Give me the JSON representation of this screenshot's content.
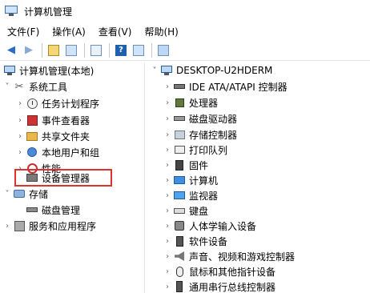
{
  "window": {
    "title": "计算机管理"
  },
  "menubar": {
    "items": [
      "文件(F)",
      "操作(A)",
      "查看(V)",
      "帮助(H)"
    ]
  },
  "toolbar": {
    "buttons": [
      "back-arrow",
      "forward-arrow",
      "up-folder",
      "show-hide-tree",
      "properties",
      "help",
      "view",
      "monitor"
    ]
  },
  "left_tree": {
    "root": "计算机管理(本地)",
    "system_tools": "系统工具",
    "task_scheduler": "任务计划程序",
    "event_viewer": "事件查看器",
    "shared_folders": "共享文件夹",
    "local_users": "本地用户和组",
    "performance": "性能",
    "device_manager": "设备管理器",
    "storage": "存储",
    "disk_management": "磁盘管理",
    "services": "服务和应用程序"
  },
  "right_tree": {
    "root": "DESKTOP-U2HDERM",
    "items": [
      "IDE ATA/ATAPI 控制器",
      "处理器",
      "磁盘驱动器",
      "存储控制器",
      "打印队列",
      "固件",
      "计算机",
      "监视器",
      "键盘",
      "人体学输入设备",
      "软件设备",
      "声音、视频和游戏控制器",
      "鼠标和其他指针设备",
      "通用串行总线控制器"
    ]
  },
  "colors": {
    "highlight": "#e03131",
    "accent": "#2b6cc4"
  }
}
